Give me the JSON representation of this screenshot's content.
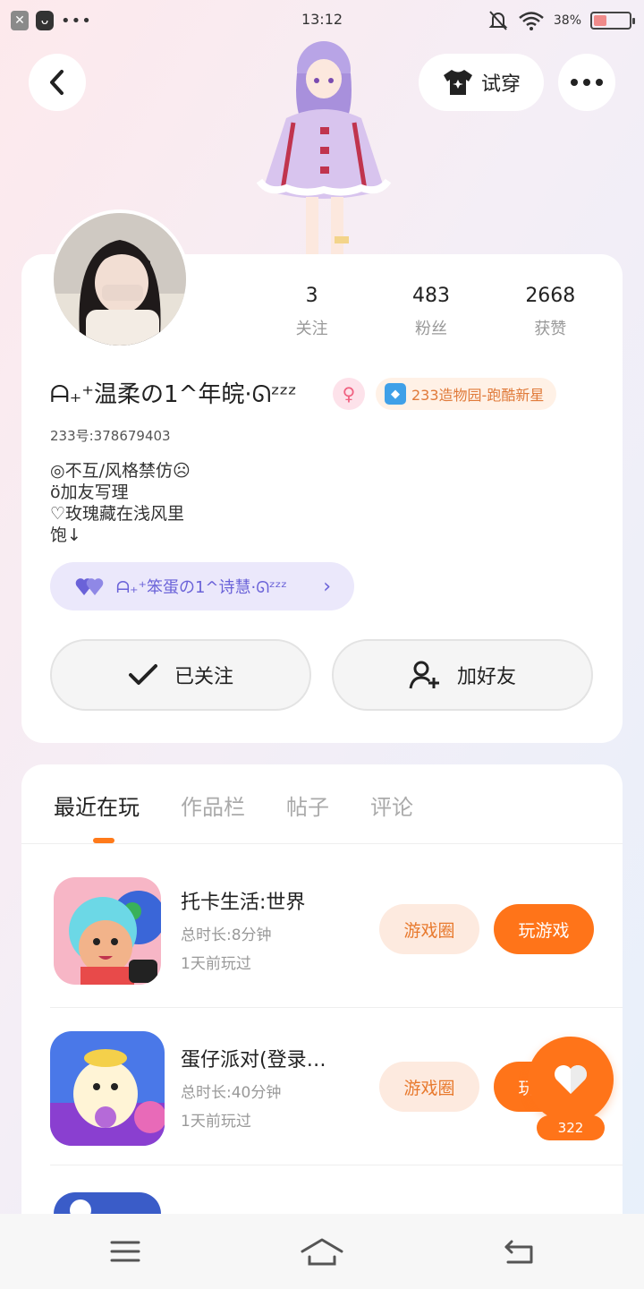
{
  "status_bar": {
    "time": "13:12",
    "battery_pct": "38%",
    "battery_level": 0.38
  },
  "header": {
    "tryon_label": "试穿"
  },
  "profile": {
    "stats": [
      {
        "value": "3",
        "label": "关注"
      },
      {
        "value": "483",
        "label": "粉丝"
      },
      {
        "value": "2668",
        "label": "获赞"
      }
    ],
    "username": "ᗩ₊⁺温柔の1^年皖·ᘏᶻᶻᶻ",
    "gender_symbol": "♀",
    "title_badge": "233造物园-跑酷新星",
    "uid": "233号:378679403",
    "bio_lines": [
      "◎不互/风格禁仿☹",
      "ö加友写理",
      "♡玫瑰藏在浅风里",
      "饱↓"
    ],
    "cp_name": "ᗩ₊⁺笨蛋の1^诗慧·ᘏᶻᶻᶻ",
    "follow_label": "已关注",
    "add_friend_label": "加好友"
  },
  "tabs": [
    "最近在玩",
    "作品栏",
    "帖子",
    "评论"
  ],
  "games": [
    {
      "name": "托卡生活:世界",
      "duration": "总时长:8分钟",
      "last_played": "1天前玩过",
      "circle_label": "游戏圈",
      "play_label": "玩游戏"
    },
    {
      "name": "蛋仔派对(登录…",
      "duration": "总时长:40分钟",
      "last_played": "1天前玩过",
      "circle_label": "游戏圈",
      "play_label": "玩游戏"
    }
  ],
  "like_count": "322",
  "colors": {
    "accent": "#ff7419",
    "cp_chip": "#ebe8fb",
    "badge_bg": "#fff1e6"
  },
  "icons": [
    "back-icon",
    "tshirt-icon",
    "more-icon",
    "check-icon",
    "add-user-icon",
    "heart-icon",
    "menu-icon",
    "home-icon",
    "return-icon"
  ]
}
